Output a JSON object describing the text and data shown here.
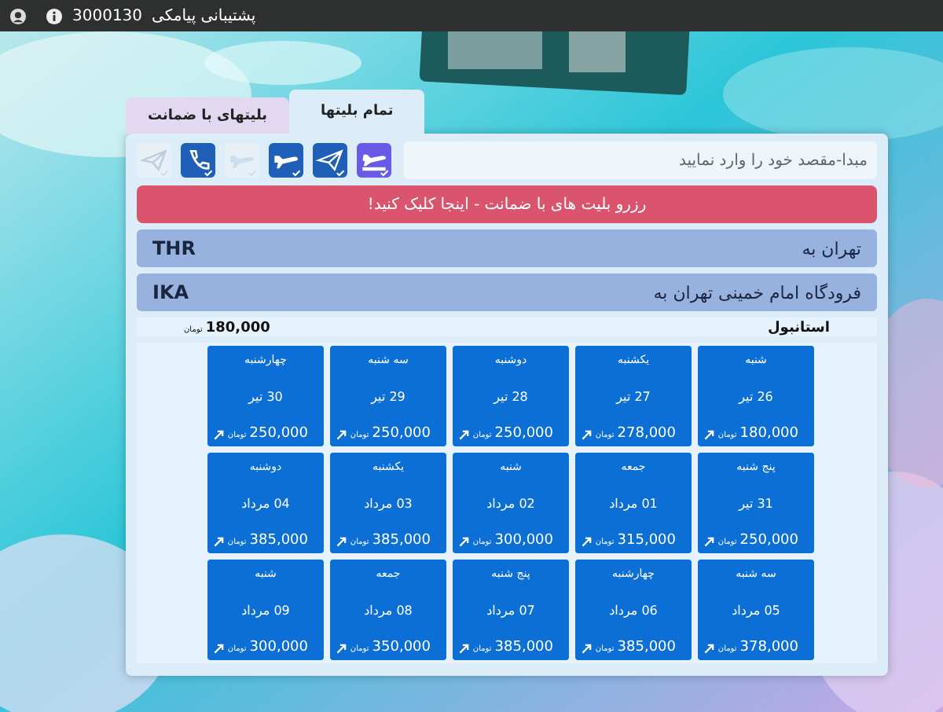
{
  "top_bar": {
    "support_label": "پشتیبانی پیامکی",
    "support_number": "3000130"
  },
  "tabs": [
    {
      "label": "تمام بلیتها",
      "selected": true
    },
    {
      "label": "بلیتهای با ضمانت",
      "selected": false
    }
  ],
  "search": {
    "placeholder": "مبدا-مقصد خود را وارد نمایید"
  },
  "filter_icons": [
    {
      "kind": "airplane-ticket",
      "active": true,
      "color": "#6a5ae8"
    },
    {
      "kind": "paper-plane",
      "active": true,
      "color": "#1f5fb8"
    },
    {
      "kind": "airplane",
      "active": true,
      "color": "#1f5fb8"
    },
    {
      "kind": "airplane",
      "active": false
    },
    {
      "kind": "phone",
      "active": true,
      "color": "#1f5fb8"
    },
    {
      "kind": "paper-plane",
      "active": false
    }
  ],
  "banner": "رزرو بلیت های با ضمانت - اینجا کلیک کنید!",
  "routes": [
    {
      "origin": "تهران به",
      "code": "THR"
    },
    {
      "origin": "فرودگاه امام خمینی تهران به",
      "code": "IKA"
    }
  ],
  "destination": {
    "name": "استانبول",
    "price": "180,000",
    "currency": "تومان"
  },
  "days": [
    {
      "day": "شنبه",
      "date": "26 تیر",
      "price": "180,000",
      "currency": "تومان"
    },
    {
      "day": "یکشنبه",
      "date": "27 تیر",
      "price": "278,000",
      "currency": "تومان"
    },
    {
      "day": "دوشنبه",
      "date": "28 تیر",
      "price": "250,000",
      "currency": "تومان"
    },
    {
      "day": "سه شنبه",
      "date": "29 تیر",
      "price": "250,000",
      "currency": "تومان"
    },
    {
      "day": "چهارشنبه",
      "date": "30 تیر",
      "price": "250,000",
      "currency": "تومان"
    },
    {
      "day": "پنج شنبه",
      "date": "31 تیر",
      "price": "250,000",
      "currency": "تومان"
    },
    {
      "day": "جمعه",
      "date": "01 مرداد",
      "price": "315,000",
      "currency": "تومان"
    },
    {
      "day": "شنبه",
      "date": "02 مرداد",
      "price": "300,000",
      "currency": "تومان"
    },
    {
      "day": "یکشنبه",
      "date": "03 مرداد",
      "price": "385,000",
      "currency": "تومان"
    },
    {
      "day": "دوشنبه",
      "date": "04 مرداد",
      "price": "385,000",
      "currency": "تومان"
    },
    {
      "day": "سه شنبه",
      "date": "05 مرداد",
      "price": "378,000",
      "currency": "تومان"
    },
    {
      "day": "چهارشنبه",
      "date": "06 مرداد",
      "price": "385,000",
      "currency": "تومان"
    },
    {
      "day": "پنج شنبه",
      "date": "07 مرداد",
      "price": "385,000",
      "currency": "تومان"
    },
    {
      "day": "جمعه",
      "date": "08 مرداد",
      "price": "350,000",
      "currency": "تومان"
    },
    {
      "day": "شنبه",
      "date": "09 مرداد",
      "price": "300,000",
      "currency": "تومان"
    }
  ]
}
